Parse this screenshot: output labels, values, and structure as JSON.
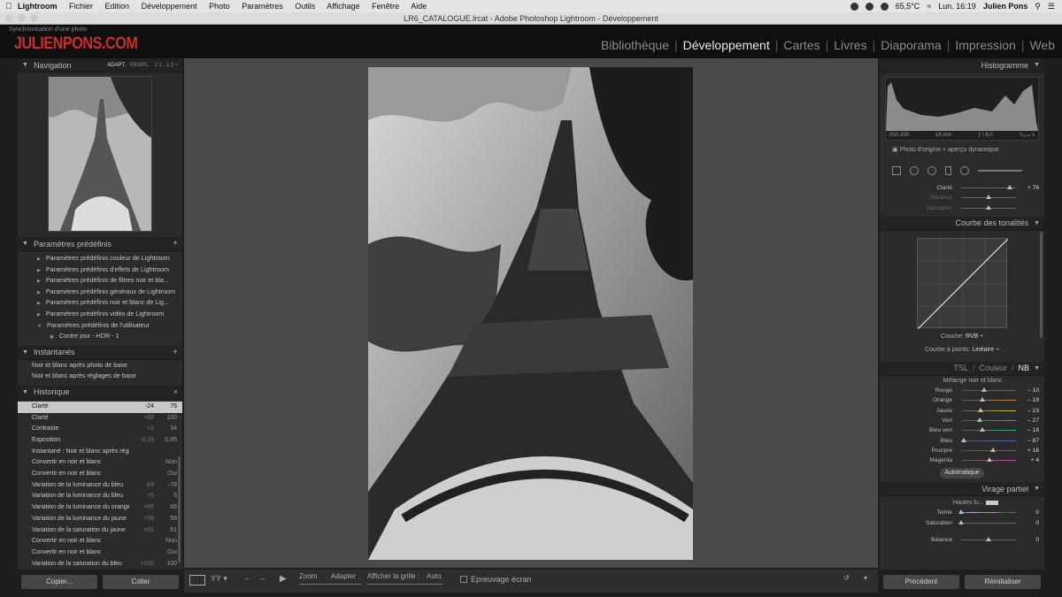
{
  "mac_menu": {
    "app_name": "Lightroom",
    "items": [
      "Fichier",
      "Edition",
      "Développement",
      "Photo",
      "Paramètres",
      "Outils",
      "Affichage",
      "Fenêtre",
      "Aide"
    ],
    "temperature": "65,5°C",
    "clock": "Lun. 16:19",
    "user": "Julien Pons"
  },
  "window": {
    "title": "LR6_CATALOGUE.lrcat - Adobe Photoshop Lightroom - Développement"
  },
  "header": {
    "sync_text": "Synchronisation d'une photo",
    "logo": "JULIENPONS.COM",
    "modules": [
      {
        "label": "Bibliothèque",
        "active": false
      },
      {
        "label": "Développement",
        "active": true
      },
      {
        "label": "Cartes",
        "active": false
      },
      {
        "label": "Livres",
        "active": false
      },
      {
        "label": "Diaporama",
        "active": false
      },
      {
        "label": "Impression",
        "active": false
      },
      {
        "label": "Web",
        "active": false
      }
    ]
  },
  "left": {
    "navigation": {
      "title": "Navigation",
      "opt1": "ADAPT.",
      "opt2": "REMPL.",
      "opt3": "1:1",
      "opt4": "1:2 ÷"
    },
    "presets": {
      "title": "Paramètres prédéfinis",
      "items": [
        "Paramètres prédéfinis couleur de Lightroom",
        "Paramètres prédéfinis d'effets de Lightroom",
        "Paramètres prédéfinis de filtres noir et bla...",
        "Paramètres prédéfinis généraux de Lightroom",
        "Paramètres prédéfinis noir et blanc de Lig...",
        "Paramètres prédéfinis vidéo de Lightroom",
        "Paramètres prédéfinis de l'utilisateur"
      ],
      "user_item": "Contre jour - HDR - 1"
    },
    "snapshots": {
      "title": "Instantanés",
      "items": [
        "Noir et blanc après photo de base",
        "Noir et blanc après réglages de base"
      ]
    },
    "history": {
      "title": "Historique",
      "rows": [
        {
          "name": "Clarté",
          "a": "-24",
          "b": "76",
          "selected": true
        },
        {
          "name": "Clarté",
          "a": "+68",
          "b": "100"
        },
        {
          "name": "Contraste",
          "a": "+2",
          "b": "34"
        },
        {
          "name": "Exposition",
          "a": "-0,15",
          "b": "0,95"
        },
        {
          "name": "Instantané : Noir et blanc après réglages de base",
          "a": "",
          "b": ""
        },
        {
          "name": "Convertir en noir et blanc",
          "a": "",
          "b": "Non"
        },
        {
          "name": "Convertir en noir et blanc",
          "a": "",
          "b": "Oui"
        },
        {
          "name": "Variation de la luminance du bleu",
          "a": "-83",
          "b": "-78"
        },
        {
          "name": "Variation de la luminance du bleu",
          "a": "+5",
          "b": "5"
        },
        {
          "name": "Variation de la luminance du orange",
          "a": "+66",
          "b": "66"
        },
        {
          "name": "Variation de la luminance du jaune",
          "a": "+58",
          "b": "58"
        },
        {
          "name": "Variation de la saturation du jaune",
          "a": "+61",
          "b": "61"
        },
        {
          "name": "Convertir en noir et blanc",
          "a": "",
          "b": "Non"
        },
        {
          "name": "Convertir en noir et blanc",
          "a": "",
          "b": "Oui"
        },
        {
          "name": "Variation de la saturation du bleu",
          "a": "+100",
          "b": "100"
        }
      ]
    },
    "copy_label": "Copier...",
    "paste_label": "Coller"
  },
  "toolbar": {
    "zoom_label": "Zoom",
    "fit_label": "Adapter",
    "grid_label": "Afficher la grille :",
    "grid_value": "Auto",
    "softproof_label": "Epreuvage écran"
  },
  "right": {
    "histogram": {
      "title": "Histogramme",
      "iso": "ISO 200",
      "focal": "18 mm",
      "aperture": "ƒ / 8,0",
      "shutter": "¹⁄₁₀₀₀ s"
    },
    "original_label": "Photo d'origine + aperçu dynamique",
    "presence": [
      {
        "label": "Clarté",
        "value": "+ 76",
        "pos": 0.88
      },
      {
        "label": "Vibrance",
        "value": "",
        "pos": 0.5,
        "dim": true
      },
      {
        "label": "Saturation",
        "value": "",
        "pos": 0.5,
        "dim": true
      }
    ],
    "tonecurve": {
      "title": "Courbe des tonalités",
      "channel_label": "Couche:",
      "channel_value": "RVB ÷",
      "points_label": "Courbe à points:",
      "points_value": "Linéaire ÷"
    },
    "bw": {
      "tab1": "TSL",
      "tab2": "Couleur",
      "tab3": "NB",
      "mix_title": "Mélange noir et blanc",
      "sliders": [
        {
          "label": "Rouge",
          "value": "– 10",
          "pos": 0.42
        },
        {
          "label": "Orange",
          "value": "– 19",
          "pos": 0.38
        },
        {
          "label": "Jaune",
          "value": "– 23",
          "pos": 0.36
        },
        {
          "label": "Vert",
          "value": "– 27",
          "pos": 0.34
        },
        {
          "label": "Bleu vert",
          "value": "– 18",
          "pos": 0.38
        },
        {
          "label": "Bleu",
          "value": "– 87",
          "pos": 0.05
        },
        {
          "label": "Pourpre",
          "value": "+ 16",
          "pos": 0.58
        },
        {
          "label": "Magenta",
          "value": "+ 4",
          "pos": 0.52
        }
      ],
      "auto_label": "Automatique"
    },
    "split": {
      "title": "Virage partiel",
      "highlights_label": "Hautes lu...",
      "sliders": [
        {
          "label": "Teinte",
          "value": "0",
          "pos": 0.0
        },
        {
          "label": "Saturation",
          "value": "0",
          "pos": 0.0
        }
      ],
      "balance": {
        "label": "Balance",
        "value": "0",
        "pos": 0.5
      }
    },
    "previous_label": "Précédent",
    "reset_label": "Réinitialiser"
  }
}
